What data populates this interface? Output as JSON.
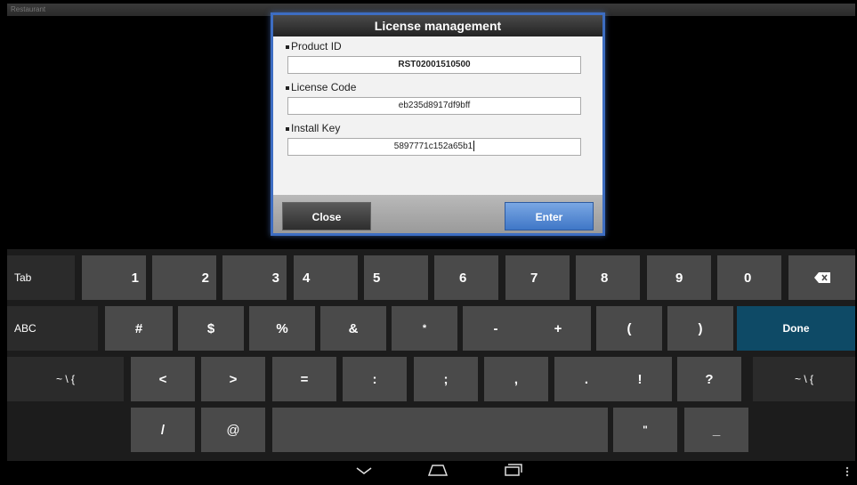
{
  "app": {
    "title": "Restaurant"
  },
  "dialog": {
    "title": "License management",
    "fields": [
      {
        "label": "Product ID",
        "value": "RST02001510500"
      },
      {
        "label": "License Code",
        "value": "eb235d8917df9bff"
      },
      {
        "label": "Install Key",
        "value": "5897771c152a65b1"
      }
    ],
    "close_label": "Close",
    "enter_label": "Enter"
  },
  "keyboard": {
    "row1": [
      "Tab",
      "1",
      "2",
      "3",
      "4",
      "5",
      "6",
      "7",
      "8",
      "9",
      "0"
    ],
    "row2": [
      "ABC",
      "#",
      "$",
      "%",
      "&",
      "*",
      "-",
      "+",
      "(",
      ")",
      "Done"
    ],
    "row3": [
      "~ \\ {",
      "<",
      ">",
      "=",
      ":",
      ";",
      ",",
      ".",
      "!",
      "?",
      "~ \\ {"
    ],
    "row4": [
      "/",
      "@",
      "\"",
      "_"
    ]
  },
  "icons": {
    "backspace": "backspace-icon",
    "nav_back": "chevron-down-icon",
    "nav_home": "home-icon",
    "nav_recent": "recent-apps-icon",
    "menu": "menu-icon"
  },
  "colors": {
    "dialog_border": "#3d6dc2",
    "enter_button": "#4f86d4",
    "done_key": "#0e4a66",
    "key": "#4a4a4a",
    "key_dark": "#2b2b2b"
  }
}
